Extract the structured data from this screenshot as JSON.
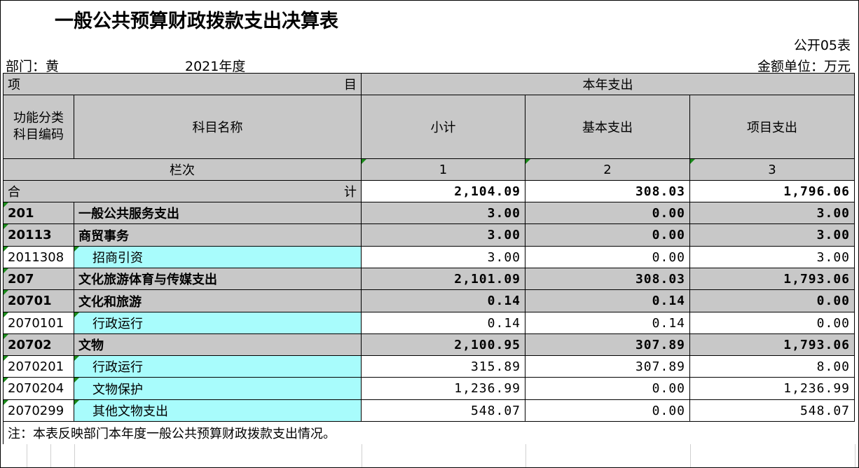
{
  "title": "一般公共预算财政拨款支出决算表",
  "form_no": "公开05表",
  "department_label": "部门：黄",
  "year": "2021年度",
  "unit_label": "金额单位：万元",
  "header": {
    "item_left": "项",
    "item_right": "目",
    "current_year": "本年支出",
    "func_code": "功能分类\n科目编码",
    "subject_name": "科目名称",
    "subtotal": "小计",
    "basic": "基本支出",
    "project": "项目支出",
    "lanci": "栏次",
    "col1": "1",
    "col2": "2",
    "col3": "3",
    "total_left": "合",
    "total_right": "计",
    "total_subtotal": "2,104.09",
    "total_basic": "308.03",
    "total_project": "1,796.06"
  },
  "rows": [
    {
      "code": "201",
      "name": "一般公共服务支出",
      "subtotal": "3.00",
      "basic": "0.00",
      "project": "3.00"
    },
    {
      "code": "20113",
      "name": "商贸事务",
      "subtotal": "3.00",
      "basic": "0.00",
      "project": "3.00"
    },
    {
      "code": "2011308",
      "name": "招商引资",
      "subtotal": "3.00",
      "basic": "0.00",
      "project": "3.00"
    },
    {
      "code": "207",
      "name": "文化旅游体育与传媒支出",
      "subtotal": "2,101.09",
      "basic": "308.03",
      "project": "1,793.06"
    },
    {
      "code": "20701",
      "name": "文化和旅游",
      "subtotal": "0.14",
      "basic": "0.14",
      "project": "0.00"
    },
    {
      "code": "2070101",
      "name": "行政运行",
      "subtotal": "0.14",
      "basic": "0.14",
      "project": "0.00"
    },
    {
      "code": "20702",
      "name": "文物",
      "subtotal": "2,100.95",
      "basic": "307.89",
      "project": "1,793.06"
    },
    {
      "code": "2070201",
      "name": "行政运行",
      "subtotal": "315.89",
      "basic": "307.89",
      "project": "8.00"
    },
    {
      "code": "2070204",
      "name": "文物保护",
      "subtotal": "1,236.99",
      "basic": "0.00",
      "project": "1,236.99"
    },
    {
      "code": "2070299",
      "name": "其他文物支出",
      "subtotal": "548.07",
      "basic": "0.00",
      "project": "548.07"
    }
  ],
  "note": "注：本表反映部门本年度一般公共预算财政拨款支出情况。",
  "colors": {
    "header_gray": "#c8c8c8",
    "detail_cyan": "#a8fcfc",
    "marker_green": "#1a8a1a"
  }
}
